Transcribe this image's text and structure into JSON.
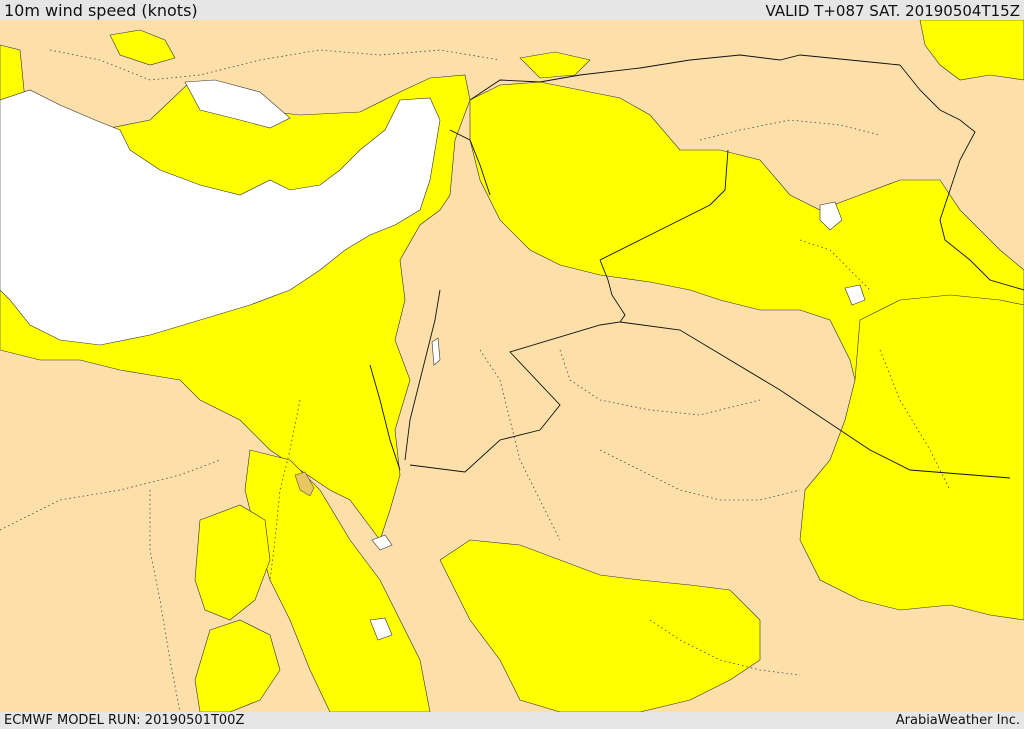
{
  "header": {
    "title": "10m wind speed (knots)",
    "valid": "VALID T+087 SAT. 20190504T15Z"
  },
  "footer": {
    "model_run": "ECMWF MODEL RUN: 20190501T00Z",
    "credit": "ArabiaWeather Inc."
  },
  "map": {
    "region": "Eastern Mediterranean and Middle East",
    "legend_colors": {
      "land_base": "#fcdfa9",
      "wind_band": "#ffff00",
      "wind_strong": "#e8c760",
      "sea_calm": "#ffffff"
    }
  }
}
